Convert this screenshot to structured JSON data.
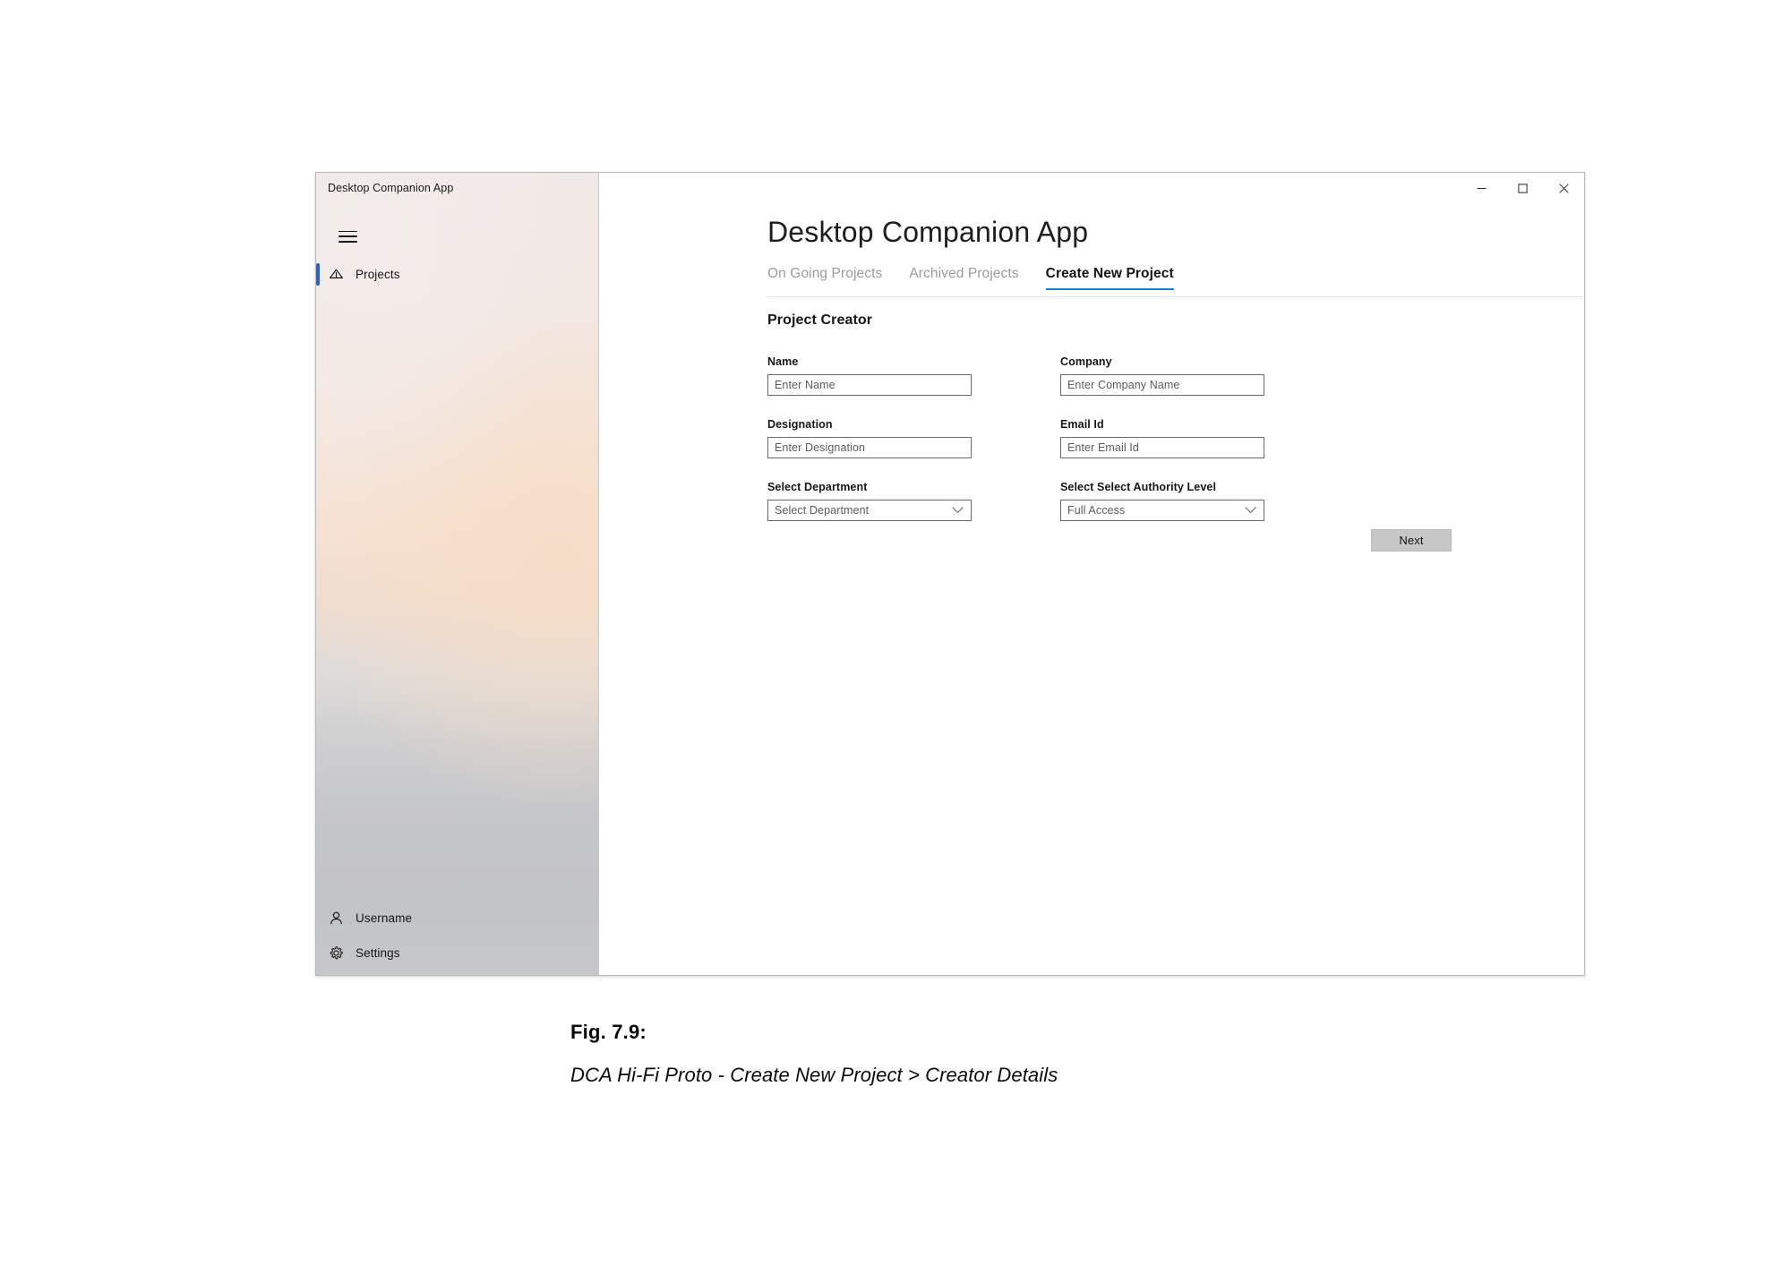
{
  "window": {
    "title": "Desktop Companion App",
    "controls": {
      "minimize": "–",
      "maximize": "□",
      "close": "✕"
    }
  },
  "sidebar": {
    "menu_icon": "hamburger-icon",
    "items": [
      {
        "label": "Projects",
        "icon": "projects-icon",
        "selected": true
      },
      {
        "label": "Username",
        "icon": "user-icon",
        "selected": false
      },
      {
        "label": "Settings",
        "icon": "gear-icon",
        "selected": false
      }
    ]
  },
  "main": {
    "heading": "Desktop Companion App",
    "tabs": [
      {
        "label": "On Going Projects",
        "active": false
      },
      {
        "label": "Archived Projects",
        "active": false
      },
      {
        "label": "Create New Project",
        "active": true
      }
    ],
    "section_title": "Project Creator",
    "fields": {
      "name": {
        "label": "Name",
        "placeholder": "Enter Name",
        "value": ""
      },
      "company": {
        "label": "Company",
        "placeholder": "Enter Company Name",
        "value": ""
      },
      "designation": {
        "label": "Designation",
        "placeholder": "Enter Designation",
        "value": ""
      },
      "email": {
        "label": "Email Id",
        "placeholder": "Enter Email Id",
        "value": ""
      },
      "department": {
        "label": "Select Department",
        "value": "Select Department"
      },
      "authority": {
        "label": "Select Select Authority Level",
        "value": "Full Access"
      }
    },
    "next_label": "Next"
  },
  "caption": {
    "number": "Fig. 7.9:",
    "text": "DCA Hi-Fi Proto - Create New Project > Creator Details"
  },
  "colors": {
    "accent_blue": "#2b62c4",
    "tab_underline": "#2b7cc4",
    "button_gray": "#c7c7c7",
    "field_border": "#6a6a6a"
  }
}
